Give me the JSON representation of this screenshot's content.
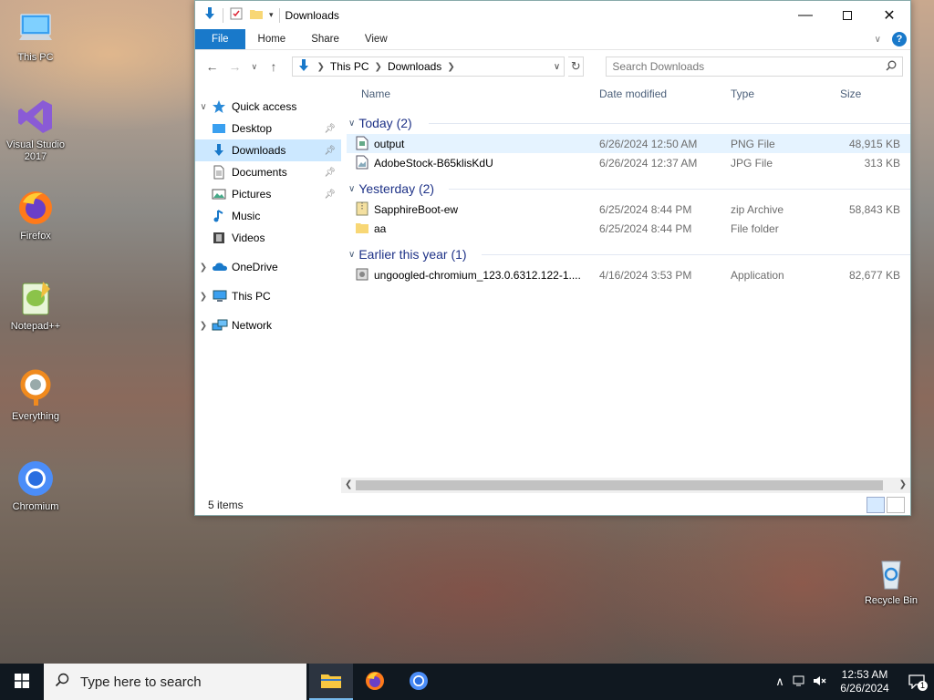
{
  "desktop": {
    "icons": [
      {
        "label": "This PC"
      },
      {
        "label": "Visual Studio 2017"
      },
      {
        "label": "Firefox"
      },
      {
        "label": "Notepad++"
      },
      {
        "label": "Everything"
      },
      {
        "label": "Chromium"
      }
    ],
    "recycle_bin": "Recycle Bin"
  },
  "window": {
    "title": "Downloads",
    "ribbon_tabs": [
      "File",
      "Home",
      "Share",
      "View"
    ],
    "help": "?",
    "address": {
      "crumbs": [
        "This PC",
        "Downloads"
      ]
    },
    "search": {
      "placeholder": "Search Downloads"
    },
    "nav": {
      "quick_access": "Quick access",
      "items": [
        "Desktop",
        "Downloads",
        "Documents",
        "Pictures",
        "Music",
        "Videos"
      ],
      "onedrive": "OneDrive",
      "this_pc": "This PC",
      "network": "Network"
    },
    "columns": {
      "name": "Name",
      "date": "Date modified",
      "type": "Type",
      "size": "Size"
    },
    "groups": [
      {
        "label": "Today (2)",
        "files": [
          {
            "name": "output",
            "date": "6/26/2024 12:50 AM",
            "type": "PNG File",
            "size": "48,915 KB"
          },
          {
            "name": "AdobeStock-B65klisKdU",
            "date": "6/26/2024 12:37 AM",
            "type": "JPG File",
            "size": "313 KB"
          }
        ]
      },
      {
        "label": "Yesterday (2)",
        "files": [
          {
            "name": "SapphireBoot-ew",
            "date": "6/25/2024 8:44 PM",
            "type": "zip Archive",
            "size": "58,843 KB"
          },
          {
            "name": "aa",
            "date": "6/25/2024 8:44 PM",
            "type": "File folder",
            "size": ""
          }
        ]
      },
      {
        "label": "Earlier this year (1)",
        "files": [
          {
            "name": "ungoogled-chromium_123.0.6312.122-1....",
            "date": "4/16/2024 3:53 PM",
            "type": "Application",
            "size": "82,677 KB"
          }
        ]
      }
    ],
    "status": "5 items"
  },
  "taskbar": {
    "search_placeholder": "Type here to search",
    "time": "12:53 AM",
    "date": "6/26/2024",
    "notifications": "1"
  },
  "colors": {
    "accent": "#1979ca",
    "selected": "#cce8ff",
    "group_text": "#1e3287"
  }
}
